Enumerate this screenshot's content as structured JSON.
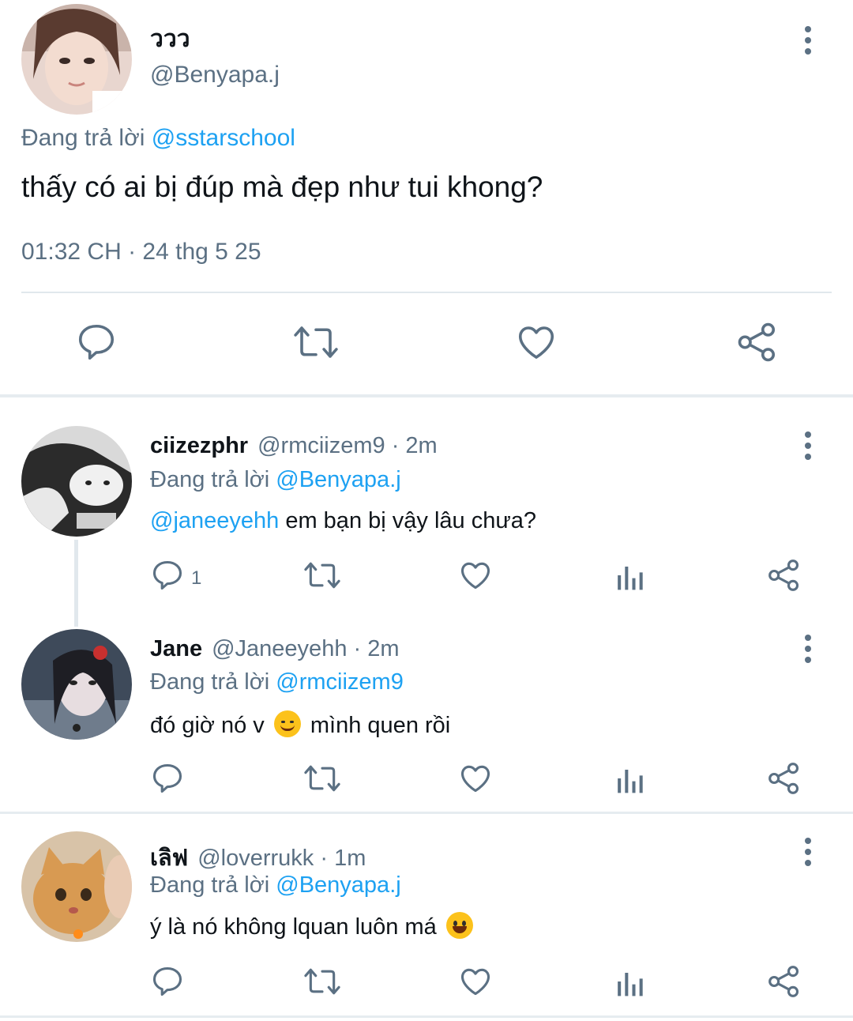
{
  "main_tweet": {
    "display_name": "ววว",
    "handle": "@Benyapa.j",
    "replying_prefix": "Đang trả lời",
    "replying_to": "@sstarschool",
    "text": "thấy có ai bị đúp mà đẹp như tui khong?",
    "timestamp": "01:32 CH · 24 thg 5 25",
    "actions": [
      "reply-icon",
      "retweet-icon",
      "like-icon",
      "share-icon"
    ]
  },
  "replies": [
    {
      "display_name": "ciizezphr",
      "handle": "@rmciizem9",
      "time": "· 2m",
      "replying_prefix": "Đang trả lời",
      "replying_to": "@Benyapa.j",
      "mention": "@janeeyehh",
      "text": " em bạn bị vậy lâu chưa?",
      "reply_count": "1"
    },
    {
      "display_name": "Jane",
      "handle": "@Janeeyehh",
      "time": "· 2m",
      "replying_prefix": "Đang trả lời",
      "replying_to": "@rmciizem9",
      "text_before": "đó giờ nó v ",
      "emoji": "smiling-face-emoji",
      "text_after": " mình quen rồi"
    },
    {
      "display_name": "เลิฟ",
      "handle": "@loverrukk",
      "time": "· 1m",
      "replying_prefix": "Đang trả lời",
      "replying_to": "@Benyapa.j",
      "text_before": "ý là nó không lquan luôn má ",
      "emoji": "grinning-face-emoji"
    }
  ],
  "colors": {
    "link": "#1da1f2",
    "secondary_text": "#5b7083",
    "icon": "#5b7083",
    "divider": "#e6ecf0"
  }
}
